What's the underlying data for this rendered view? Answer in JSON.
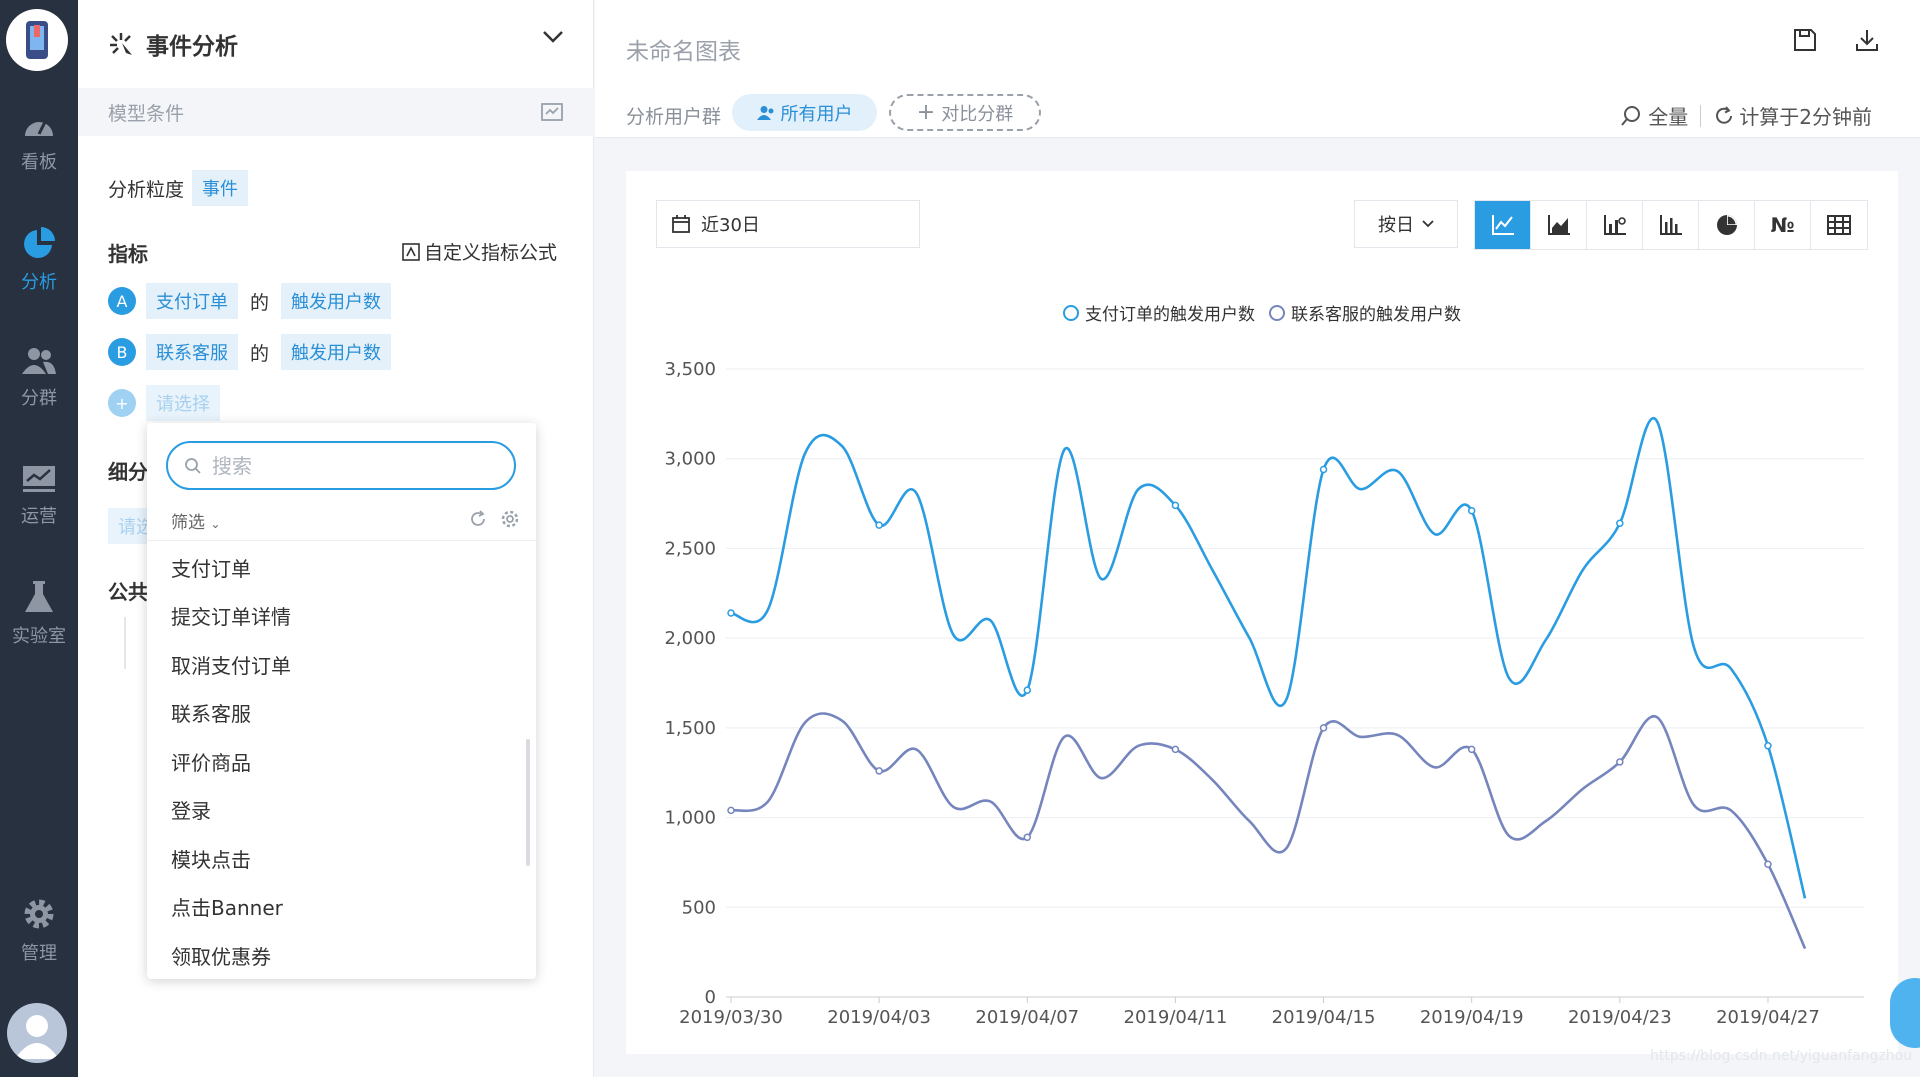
{
  "nav": {
    "items": [
      {
        "label": "看板",
        "icon": "gauge-icon"
      },
      {
        "label": "分析",
        "icon": "pie-chart-icon",
        "active": true
      },
      {
        "label": "分群",
        "icon": "users-icon"
      },
      {
        "label": "运营",
        "icon": "trend-monitor-icon"
      },
      {
        "label": "实验室",
        "icon": "flask-icon"
      },
      {
        "label": "管理",
        "icon": "gear-icon"
      }
    ]
  },
  "panel": {
    "title": "事件分析",
    "model_label": "模型条件",
    "granularity_label": "分析粒度",
    "granularity_value": "事件",
    "metrics_title": "指标",
    "custom_formula": "自定义指标公式",
    "metrics": [
      {
        "badge": "A",
        "event": "支付订单",
        "joiner": "的",
        "measure": "触发用户数"
      },
      {
        "badge": "B",
        "event": "联系客服",
        "joiner": "的",
        "measure": "触发用户数"
      }
    ],
    "add_placeholder": "请选择",
    "breakdown_title": "细分",
    "breakdown_placeholder": "请选",
    "public_title": "公共"
  },
  "popup": {
    "search_placeholder": "搜索",
    "filter_label": "筛选",
    "options": [
      "支付订单",
      "提交订单详情",
      "取消支付订单",
      "联系客服",
      "评价商品",
      "登录",
      "模块点击",
      "点击Banner",
      "领取优惠券"
    ]
  },
  "topbar": {
    "chart_title": "未命名图表",
    "crowd_label": "分析用户群",
    "crowd_value": "所有用户",
    "compare_label": "对比分群",
    "scope_label": "全量",
    "computed_label": "计算于2分钟前"
  },
  "card": {
    "date_range": "近30日",
    "granularity": "按日",
    "chart_types": [
      "line",
      "area",
      "combo",
      "bar",
      "pie",
      "number",
      "table"
    ],
    "number_glyph": "№"
  },
  "colors": {
    "accent": "#2a9ce2",
    "series1": "#2a9ce2",
    "series2": "#7585bd",
    "nav_bg": "#283140"
  },
  "watermark": "https://blog.csdn.net/yiguanfangzhou",
  "chart_data": {
    "type": "line",
    "title": "",
    "xlabel": "",
    "ylabel": "",
    "ylim": [
      0,
      3500
    ],
    "yticks": [
      0,
      500,
      1000,
      1500,
      2000,
      2500,
      3000,
      3500
    ],
    "xtick_labels": [
      "2019/03/30",
      "2019/04/03",
      "2019/04/07",
      "2019/04/11",
      "2019/04/15",
      "2019/04/19",
      "2019/04/23",
      "2019/04/27"
    ],
    "x": [
      "2019/03/30",
      "2019/03/31",
      "2019/04/01",
      "2019/04/02",
      "2019/04/03",
      "2019/04/04",
      "2019/04/05",
      "2019/04/06",
      "2019/04/07",
      "2019/04/08",
      "2019/04/09",
      "2019/04/10",
      "2019/04/11",
      "2019/04/12",
      "2019/04/13",
      "2019/04/14",
      "2019/04/15",
      "2019/04/16",
      "2019/04/17",
      "2019/04/18",
      "2019/04/19",
      "2019/04/20",
      "2019/04/21",
      "2019/04/22",
      "2019/04/23",
      "2019/04/24",
      "2019/04/25",
      "2019/04/26",
      "2019/04/27",
      "2019/04/28"
    ],
    "legend": [
      "支付订单的触发用户数",
      "联系客服的触发用户数"
    ],
    "legend_position": "top-center",
    "grid": true,
    "series": [
      {
        "name": "支付订单的触发用户数",
        "values": [
          2140,
          2160,
          3030,
          3070,
          2630,
          2810,
          2020,
          2100,
          1710,
          3050,
          2330,
          2830,
          2740,
          2380,
          2000,
          1660,
          2940,
          2830,
          2930,
          2580,
          2710,
          1780,
          1990,
          2380,
          2640,
          3210,
          1950,
          1830,
          1400,
          550
        ]
      },
      {
        "name": "联系客服的触发用户数",
        "values": [
          1040,
          1090,
          1530,
          1540,
          1260,
          1380,
          1060,
          1090,
          890,
          1450,
          1220,
          1400,
          1380,
          1210,
          980,
          830,
          1500,
          1450,
          1460,
          1280,
          1380,
          900,
          980,
          1160,
          1310,
          1560,
          1070,
          1040,
          740,
          270
        ]
      }
    ]
  }
}
